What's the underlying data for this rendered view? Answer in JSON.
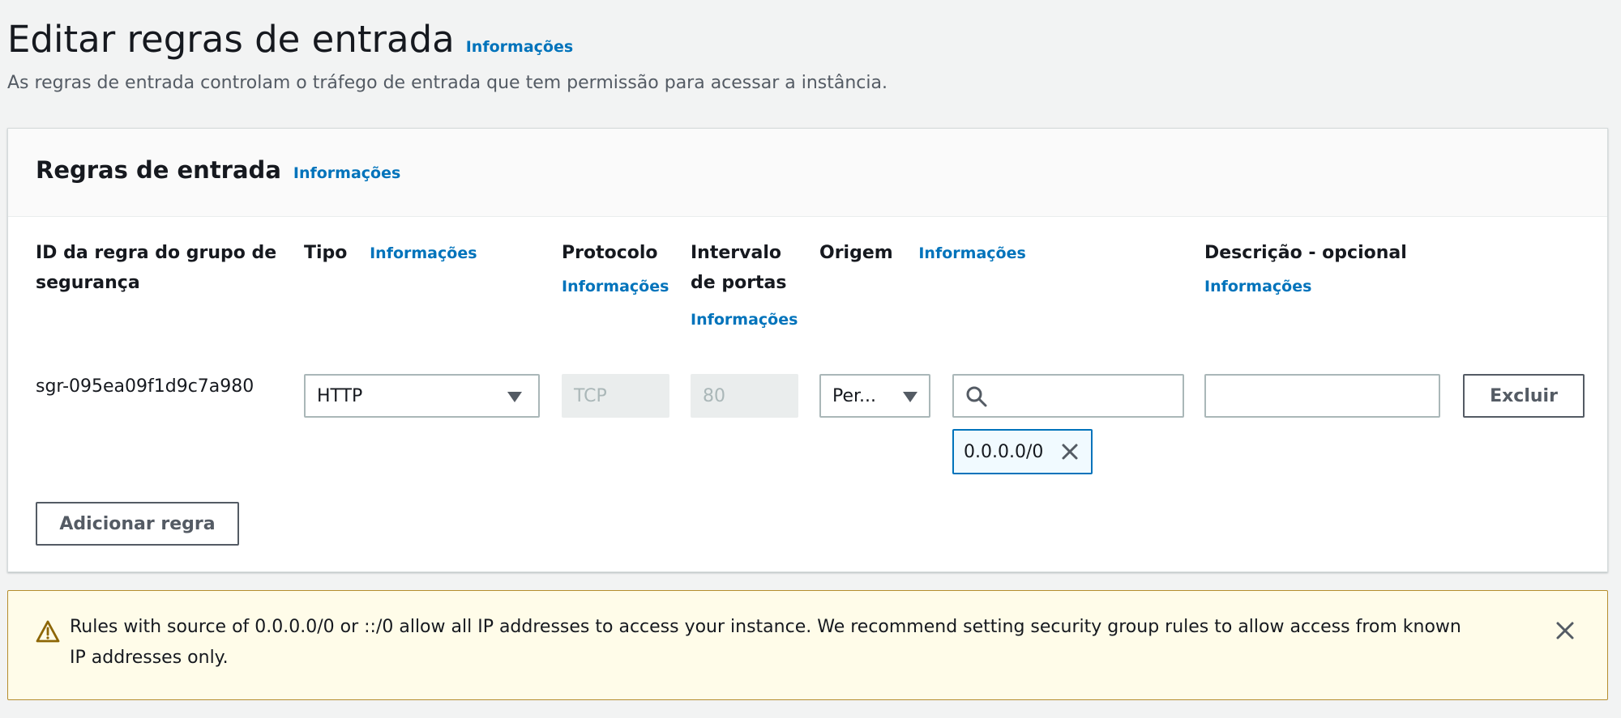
{
  "page": {
    "title": "Editar regras de entrada",
    "title_info": "Informações",
    "description": "As regras de entrada controlam o tráfego de entrada que tem permissão para acessar a instância."
  },
  "panel": {
    "title": "Regras de entrada",
    "info": "Informações",
    "columns": {
      "rule_id": "ID da regra do grupo de segurança",
      "type": "Tipo",
      "type_info": "Informações",
      "protocol": "Protocolo",
      "protocol_info": "Informações",
      "port_range": "Intervalo de portas",
      "port_range_info": "Informações",
      "source": "Origem",
      "source_info": "Informações",
      "description": "Descrição - opcional",
      "description_info": "Informações"
    },
    "rule": {
      "id": "sgr-095ea09f1d9c7a980",
      "type": "HTTP",
      "protocol": "TCP",
      "port": "80",
      "source_mode": "Per...",
      "source_search_value": "",
      "source_token": "0.0.0.0/0",
      "description_value": "",
      "delete_label": "Excluir"
    },
    "add_rule_label": "Adicionar regra"
  },
  "alert": {
    "text": "Rules with source of 0.0.0.0/0 or ::/0 allow all IP addresses to access your instance. We recommend setting security group rules to allow access from known IP addresses only."
  },
  "icons": {
    "search": "search-icon",
    "dropdown": "caret-down-icon",
    "remove_token": "close-icon",
    "warning": "warning-icon",
    "dismiss": "close-icon"
  },
  "colors": {
    "link": "#0073bb",
    "alert_background": "#fffce9",
    "alert_border": "#b58d2e",
    "token_border": "#0073bb"
  }
}
